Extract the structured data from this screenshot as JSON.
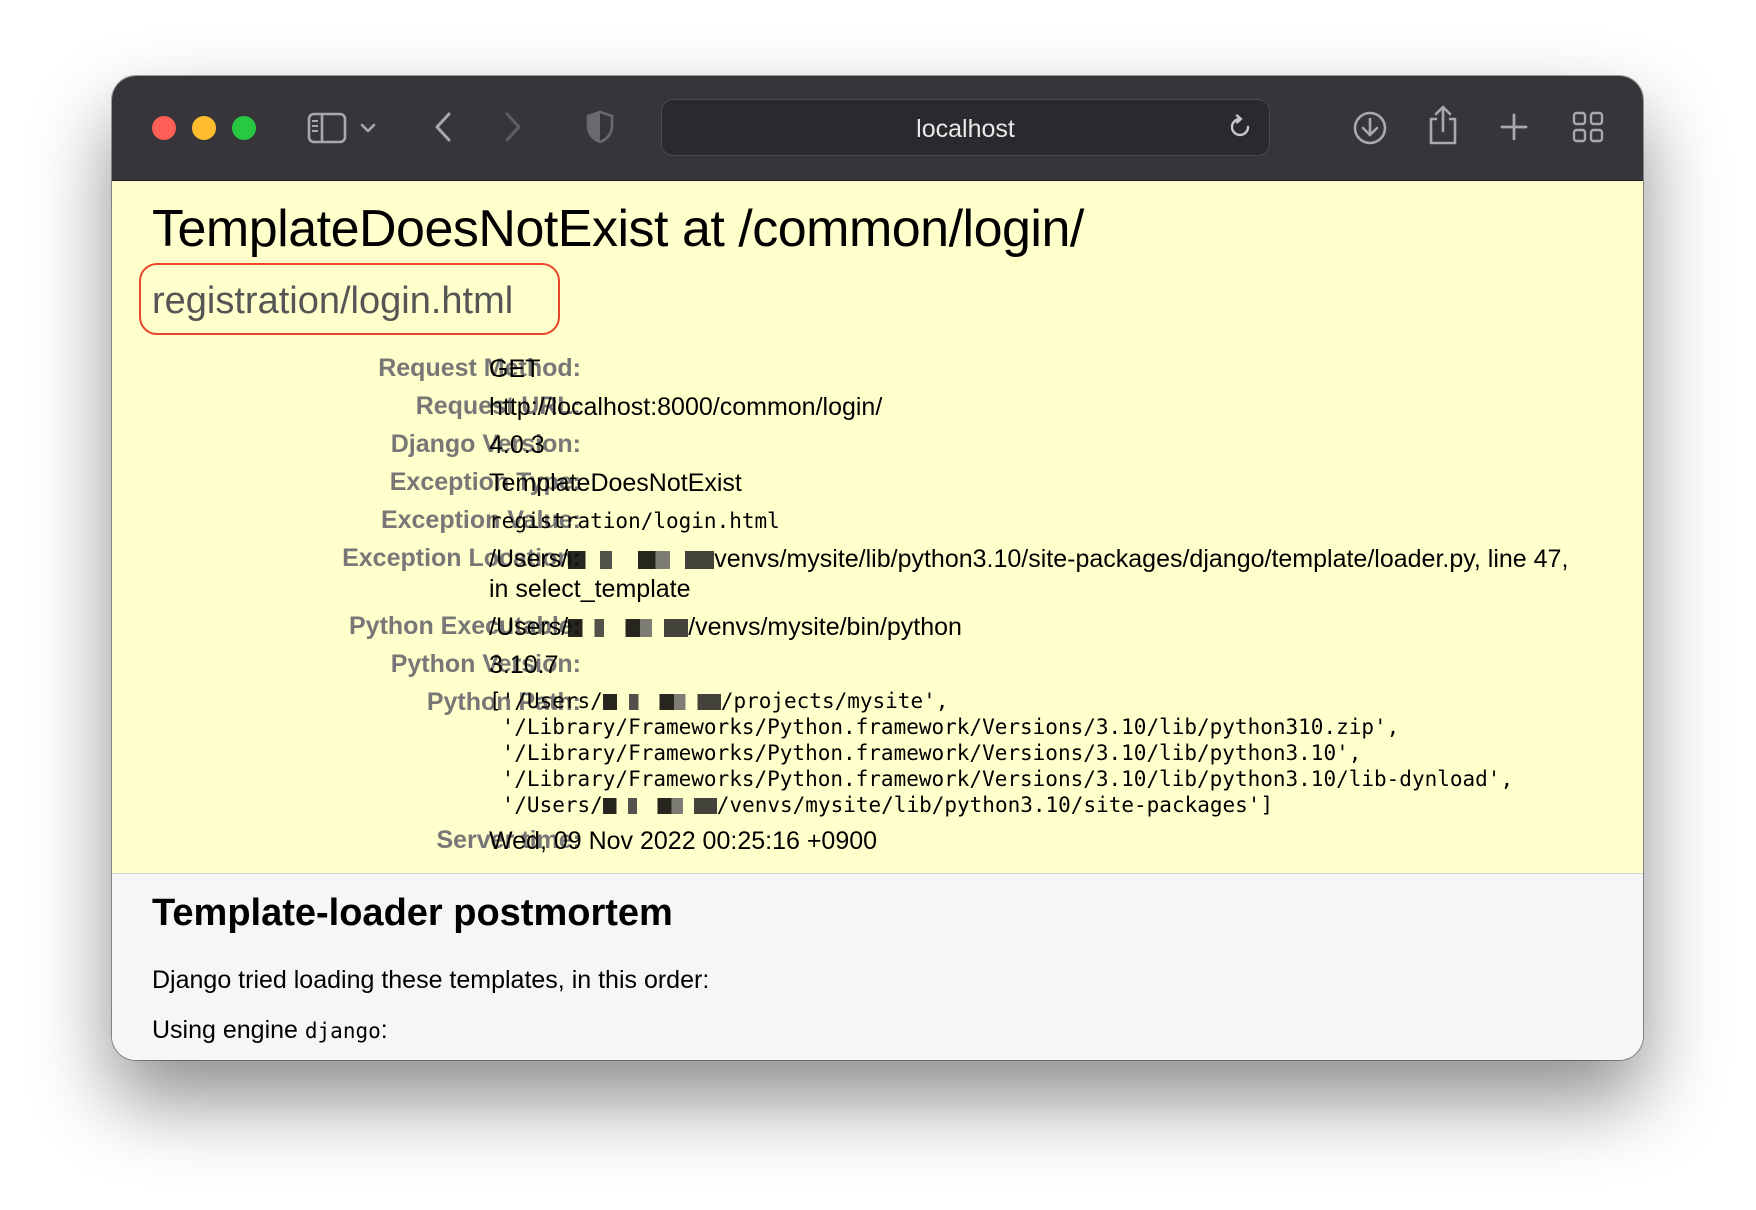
{
  "browser": {
    "address": "localhost",
    "traffic_lights": {
      "close": "#fe5f57",
      "minimize": "#febc2e",
      "maximize": "#28c840"
    },
    "icons": [
      "sidebar-icon",
      "chevron-down-icon",
      "back-icon",
      "forward-icon",
      "shield-icon",
      "reload-icon",
      "download-icon",
      "share-icon",
      "plus-icon",
      "tab-overview-icon"
    ]
  },
  "error": {
    "title": "TemplateDoesNotExist at /common/login/",
    "subtitle": "registration/login.html",
    "highlight_color": "#e8442a",
    "background": "#ffffcc"
  },
  "meta": [
    {
      "label": "Request Method:",
      "value": "GET"
    },
    {
      "label": "Request URL:",
      "value": "http://localhost:8000/common/login/"
    },
    {
      "label": "Django Version:",
      "value": "4.0.3"
    },
    {
      "label": "Exception Type:",
      "value": "TemplateDoesNotExist"
    },
    {
      "label": "Exception Value:",
      "value": "registration/login.html"
    },
    {
      "label": "Exception Location:",
      "value_pre": "/Users/",
      "value_post": "venvs/mysite/lib/python3.10/site-packages/django/template/loader.py, line 47,",
      "value_line2": "in select_template"
    },
    {
      "label": "Python Executable:",
      "value_pre": "/Users/",
      "value_post": "/venvs/mysite/bin/python"
    },
    {
      "label": "Python Version:",
      "value": "3.10.7"
    },
    {
      "label": "Python Path:",
      "lines": [
        {
          "pre": "['/Users/",
          "post": "/projects/mysite',"
        },
        {
          "text": " '/Library/Frameworks/Python.framework/Versions/3.10/lib/python310.zip',"
        },
        {
          "text": " '/Library/Frameworks/Python.framework/Versions/3.10/lib/python3.10',"
        },
        {
          "text": " '/Library/Frameworks/Python.framework/Versions/3.10/lib/python3.10/lib-dynload',"
        },
        {
          "pre": " '/Users/",
          "post": "/venvs/mysite/lib/python3.10/site-packages']"
        }
      ]
    },
    {
      "label": "Server time:",
      "value": "Wed, 09 Nov 2022 00:25:16 +0900"
    }
  ],
  "postmortem": {
    "title": "Template-loader postmortem",
    "intro": "Django tried loading these templates, in this order:",
    "engine_prefix": "Using engine ",
    "engine_name": "django",
    "engine_suffix": ":"
  }
}
